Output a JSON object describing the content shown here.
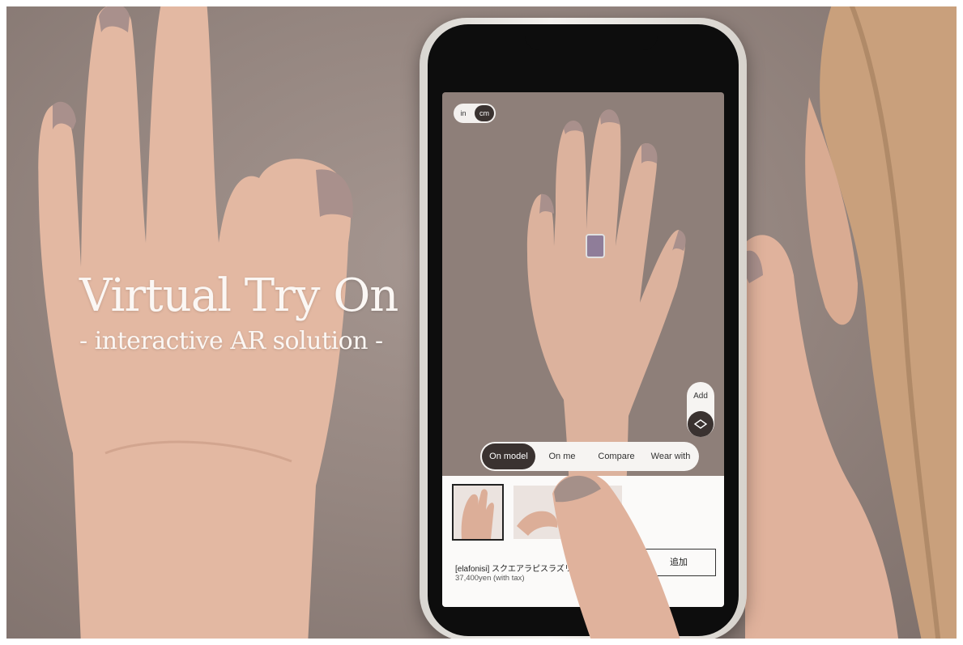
{
  "headline": {
    "title": "Virtual Try On",
    "subtitle": "- interactive AR solution -"
  },
  "app": {
    "unit_toggle": {
      "options": [
        "in",
        "cm"
      ],
      "selected": "cm"
    },
    "add_button": {
      "label": "Add",
      "icon": "diamond-outline-icon"
    },
    "tabs": [
      {
        "label": "On model",
        "active": true
      },
      {
        "label": "On me",
        "active": false
      },
      {
        "label": "Compare",
        "active": false
      },
      {
        "label": "Wear with",
        "active": false
      }
    ],
    "product": {
      "name": "[elafonisi] スクエアラピスラズリ",
      "price": "37,400yen (with tax)",
      "cart_label": "追加"
    },
    "thumbnails": [
      "hands-thumbnail",
      "hands-thumbnail",
      "hands-thumbnail"
    ]
  },
  "colors": {
    "background": "#958680",
    "accent_dark": "#3a3230",
    "pill_bg": "#f6f4f2",
    "headline_text": "#fbf7f4"
  }
}
